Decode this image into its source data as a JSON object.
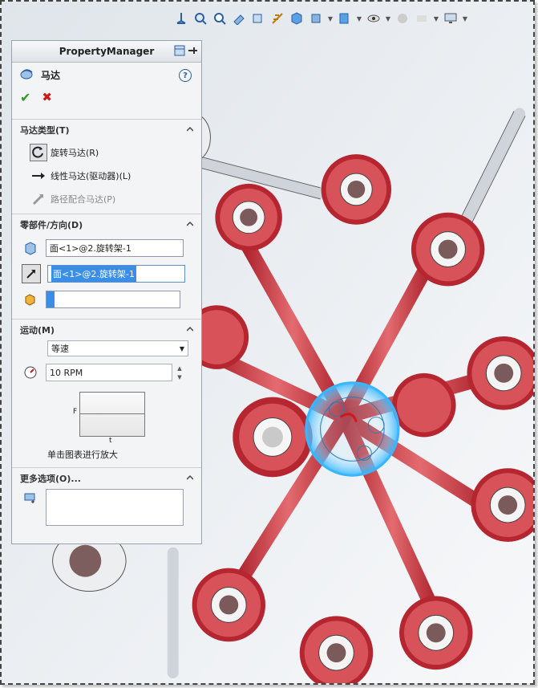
{
  "panel": {
    "header_title": "PropertyManager",
    "feature_title": "马达",
    "help_label": "?",
    "ok_symbol": "✔",
    "cancel_symbol": "✖"
  },
  "motor_type": {
    "title": "马达类型(T)",
    "options": [
      {
        "label": "旋转马达(R)",
        "selected": true,
        "icon": "rotary-motor-icon"
      },
      {
        "label": "线性马达(驱动器)(L)",
        "selected": false,
        "icon": "linear-motor-icon"
      },
      {
        "label": "路径配合马达(P)",
        "selected": false,
        "icon": "path-mate-motor-icon",
        "disabled": true
      }
    ]
  },
  "component_direction": {
    "title": "零部件/方向(D)",
    "location_value": "面<1>@2.旋转架-1",
    "direction_value": "面<1>@2.旋转架-1",
    "component_value": ""
  },
  "motion": {
    "title": "运动(M)",
    "type_value": "等速",
    "speed_value": "10 RPM",
    "graph_y_label": "F",
    "graph_x_label": "t",
    "graph_caption": "单击图表进行放大"
  },
  "more_options": {
    "title": "更多选项(O)..."
  },
  "colors": {
    "accent": "#3a8ee6",
    "model_red": "#c8323a",
    "highlight_cyan": "#38b6ff"
  }
}
